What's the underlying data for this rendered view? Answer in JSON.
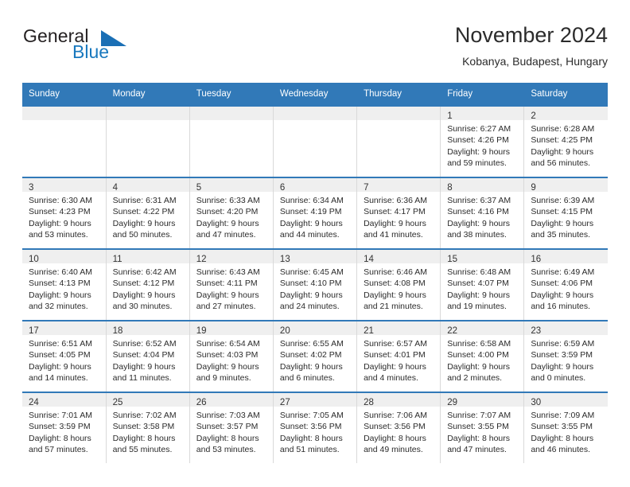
{
  "brand": {
    "name_part1": "General",
    "name_part2": "Blue",
    "logo_icon": "blue-triangle-logo"
  },
  "header": {
    "title": "November 2024",
    "location": "Kobanya, Budapest, Hungary"
  },
  "colors": {
    "header_blue": "#3179b8",
    "brand_blue": "#1878be",
    "daystrip_gray": "#efefef",
    "grid_gray": "#d9d9d9",
    "text": "#2b2b2b"
  },
  "weekdays": [
    "Sunday",
    "Monday",
    "Tuesday",
    "Wednesday",
    "Thursday",
    "Friday",
    "Saturday"
  ],
  "weeks": [
    [
      {
        "day": "",
        "lines": []
      },
      {
        "day": "",
        "lines": []
      },
      {
        "day": "",
        "lines": []
      },
      {
        "day": "",
        "lines": []
      },
      {
        "day": "",
        "lines": []
      },
      {
        "day": "1",
        "lines": [
          "Sunrise: 6:27 AM",
          "Sunset: 4:26 PM",
          "Daylight: 9 hours",
          "and 59 minutes."
        ]
      },
      {
        "day": "2",
        "lines": [
          "Sunrise: 6:28 AM",
          "Sunset: 4:25 PM",
          "Daylight: 9 hours",
          "and 56 minutes."
        ]
      }
    ],
    [
      {
        "day": "3",
        "lines": [
          "Sunrise: 6:30 AM",
          "Sunset: 4:23 PM",
          "Daylight: 9 hours",
          "and 53 minutes."
        ]
      },
      {
        "day": "4",
        "lines": [
          "Sunrise: 6:31 AM",
          "Sunset: 4:22 PM",
          "Daylight: 9 hours",
          "and 50 minutes."
        ]
      },
      {
        "day": "5",
        "lines": [
          "Sunrise: 6:33 AM",
          "Sunset: 4:20 PM",
          "Daylight: 9 hours",
          "and 47 minutes."
        ]
      },
      {
        "day": "6",
        "lines": [
          "Sunrise: 6:34 AM",
          "Sunset: 4:19 PM",
          "Daylight: 9 hours",
          "and 44 minutes."
        ]
      },
      {
        "day": "7",
        "lines": [
          "Sunrise: 6:36 AM",
          "Sunset: 4:17 PM",
          "Daylight: 9 hours",
          "and 41 minutes."
        ]
      },
      {
        "day": "8",
        "lines": [
          "Sunrise: 6:37 AM",
          "Sunset: 4:16 PM",
          "Daylight: 9 hours",
          "and 38 minutes."
        ]
      },
      {
        "day": "9",
        "lines": [
          "Sunrise: 6:39 AM",
          "Sunset: 4:15 PM",
          "Daylight: 9 hours",
          "and 35 minutes."
        ]
      }
    ],
    [
      {
        "day": "10",
        "lines": [
          "Sunrise: 6:40 AM",
          "Sunset: 4:13 PM",
          "Daylight: 9 hours",
          "and 32 minutes."
        ]
      },
      {
        "day": "11",
        "lines": [
          "Sunrise: 6:42 AM",
          "Sunset: 4:12 PM",
          "Daylight: 9 hours",
          "and 30 minutes."
        ]
      },
      {
        "day": "12",
        "lines": [
          "Sunrise: 6:43 AM",
          "Sunset: 4:11 PM",
          "Daylight: 9 hours",
          "and 27 minutes."
        ]
      },
      {
        "day": "13",
        "lines": [
          "Sunrise: 6:45 AM",
          "Sunset: 4:10 PM",
          "Daylight: 9 hours",
          "and 24 minutes."
        ]
      },
      {
        "day": "14",
        "lines": [
          "Sunrise: 6:46 AM",
          "Sunset: 4:08 PM",
          "Daylight: 9 hours",
          "and 21 minutes."
        ]
      },
      {
        "day": "15",
        "lines": [
          "Sunrise: 6:48 AM",
          "Sunset: 4:07 PM",
          "Daylight: 9 hours",
          "and 19 minutes."
        ]
      },
      {
        "day": "16",
        "lines": [
          "Sunrise: 6:49 AM",
          "Sunset: 4:06 PM",
          "Daylight: 9 hours",
          "and 16 minutes."
        ]
      }
    ],
    [
      {
        "day": "17",
        "lines": [
          "Sunrise: 6:51 AM",
          "Sunset: 4:05 PM",
          "Daylight: 9 hours",
          "and 14 minutes."
        ]
      },
      {
        "day": "18",
        "lines": [
          "Sunrise: 6:52 AM",
          "Sunset: 4:04 PM",
          "Daylight: 9 hours",
          "and 11 minutes."
        ]
      },
      {
        "day": "19",
        "lines": [
          "Sunrise: 6:54 AM",
          "Sunset: 4:03 PM",
          "Daylight: 9 hours",
          "and 9 minutes."
        ]
      },
      {
        "day": "20",
        "lines": [
          "Sunrise: 6:55 AM",
          "Sunset: 4:02 PM",
          "Daylight: 9 hours",
          "and 6 minutes."
        ]
      },
      {
        "day": "21",
        "lines": [
          "Sunrise: 6:57 AM",
          "Sunset: 4:01 PM",
          "Daylight: 9 hours",
          "and 4 minutes."
        ]
      },
      {
        "day": "22",
        "lines": [
          "Sunrise: 6:58 AM",
          "Sunset: 4:00 PM",
          "Daylight: 9 hours",
          "and 2 minutes."
        ]
      },
      {
        "day": "23",
        "lines": [
          "Sunrise: 6:59 AM",
          "Sunset: 3:59 PM",
          "Daylight: 9 hours",
          "and 0 minutes."
        ]
      }
    ],
    [
      {
        "day": "24",
        "lines": [
          "Sunrise: 7:01 AM",
          "Sunset: 3:59 PM",
          "Daylight: 8 hours",
          "and 57 minutes."
        ]
      },
      {
        "day": "25",
        "lines": [
          "Sunrise: 7:02 AM",
          "Sunset: 3:58 PM",
          "Daylight: 8 hours",
          "and 55 minutes."
        ]
      },
      {
        "day": "26",
        "lines": [
          "Sunrise: 7:03 AM",
          "Sunset: 3:57 PM",
          "Daylight: 8 hours",
          "and 53 minutes."
        ]
      },
      {
        "day": "27",
        "lines": [
          "Sunrise: 7:05 AM",
          "Sunset: 3:56 PM",
          "Daylight: 8 hours",
          "and 51 minutes."
        ]
      },
      {
        "day": "28",
        "lines": [
          "Sunrise: 7:06 AM",
          "Sunset: 3:56 PM",
          "Daylight: 8 hours",
          "and 49 minutes."
        ]
      },
      {
        "day": "29",
        "lines": [
          "Sunrise: 7:07 AM",
          "Sunset: 3:55 PM",
          "Daylight: 8 hours",
          "and 47 minutes."
        ]
      },
      {
        "day": "30",
        "lines": [
          "Sunrise: 7:09 AM",
          "Sunset: 3:55 PM",
          "Daylight: 8 hours",
          "and 46 minutes."
        ]
      }
    ]
  ]
}
